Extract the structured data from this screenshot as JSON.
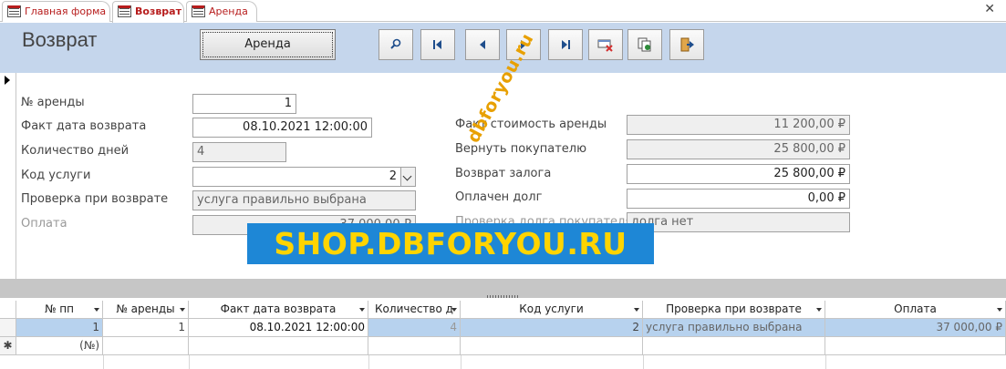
{
  "tabs": [
    {
      "label": "Главная форма"
    },
    {
      "label": "Возврат"
    },
    {
      "label": "Аренда"
    }
  ],
  "close_glyph": "✕",
  "header": {
    "title": "Возврат",
    "arenda_button": "Аренда",
    "nav_icons": [
      "search-icon",
      "first-record-icon",
      "previous-record-icon",
      "next-record-icon",
      "last-record-icon",
      "delete-record-icon",
      "copy-record-icon",
      "exit-icon"
    ]
  },
  "form": {
    "left": [
      {
        "label": "№ аренды",
        "value": "1"
      },
      {
        "label": "Факт дата возврата",
        "value": "08.10.2021 12:00:00"
      },
      {
        "label": "Количество дней",
        "value": "4"
      },
      {
        "label": "Код услуги",
        "value": "2"
      },
      {
        "label": "Проверка при возврате",
        "value": "услуга правильно выбрана"
      },
      {
        "label": "Оплата",
        "value": "37 000,00 ₽"
      }
    ],
    "right": [
      {
        "label": "Факт стоимость аренды",
        "value": "11 200,00 ₽"
      },
      {
        "label": "Вернуть покупателю",
        "value": "25 800,00 ₽"
      },
      {
        "label": "Возврат залога",
        "value": "25 800,00 ₽"
      },
      {
        "label": "Оплачен долг",
        "value": "0,00 ₽"
      },
      {
        "label": "Проверка долга покупателя",
        "value": "долга нет"
      }
    ]
  },
  "watermarks": {
    "diagonal": "dbforyou.ru",
    "banner": "SHOP.DBFORYOU.RU"
  },
  "grid": {
    "columns": [
      "№ пп",
      "№ аренды",
      "Факт дата возврата",
      "Количество д",
      "Код услуги",
      "Проверка при возврате",
      "Оплата"
    ],
    "rows": [
      [
        "1",
        "1",
        "08.10.2021 12:00:00",
        "4",
        "2",
        "услуга правильно выбрана",
        "37 000,00 ₽"
      ]
    ],
    "new_row": {
      "marker": "✱",
      "id": "(№)"
    }
  },
  "colors": {
    "header_bg": "#c5d6ec",
    "tab_text": "#b71c1c",
    "selected_row": "#b7d2ee",
    "banner_bg": "#1e87d6",
    "banner_text": "#ffd400"
  }
}
